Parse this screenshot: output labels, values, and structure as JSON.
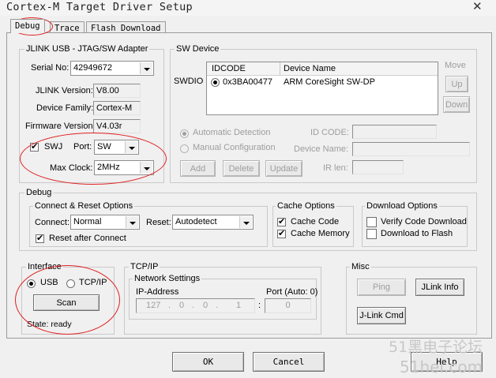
{
  "window": {
    "title": "Cortex-M Target Driver Setup",
    "close_glyph": "✕"
  },
  "tabs": [
    {
      "label": "Debug",
      "active": true
    },
    {
      "label": "Trace",
      "active": false
    },
    {
      "label": "Flash Download",
      "active": false
    }
  ],
  "jlink": {
    "group_title": "JLINK USB - JTAG/SW Adapter",
    "serial_label": "Serial No:",
    "serial_value": "42949672",
    "version_label": "JLINK Version:",
    "version_value": "V8.00",
    "family_label": "Device Family:",
    "family_value": "Cortex-M",
    "firmware_label": "Firmware Version:",
    "firmware_value": "V4.03r",
    "swj_label": "SWJ",
    "swj_checked": true,
    "port_label": "Port:",
    "port_value": "SW",
    "clock_label": "Max Clock:",
    "clock_value": "2MHz"
  },
  "sw_device": {
    "group_title": "SW Device",
    "swdio_label": "SWDIO",
    "columns": [
      "IDCODE",
      "Device Name"
    ],
    "rows": [
      {
        "idcode": "0x3BA00477",
        "device_name": "ARM CoreSight SW-DP",
        "selected": true
      }
    ],
    "move_label": "Move",
    "up_label": "Up",
    "down_label": "Down",
    "auto_detect_label": "Automatic Detection",
    "manual_config_label": "Manual Configuration",
    "idcode_label": "ID CODE:",
    "device_name_label": "Device Name:",
    "add_label": "Add",
    "delete_label": "Delete",
    "update_label": "Update",
    "ir_len_label": "IR len:"
  },
  "debug": {
    "group_title": "Debug",
    "connect_group_title": "Connect & Reset Options",
    "connect_label": "Connect:",
    "connect_value": "Normal",
    "reset_label": "Reset:",
    "reset_value": "Autodetect",
    "reset_after_connect_label": "Reset after Connect",
    "reset_after_connect_checked": true,
    "cache_group_title": "Cache Options",
    "cache_code_label": "Cache Code",
    "cache_code_checked": true,
    "cache_memory_label": "Cache Memory",
    "cache_memory_checked": true,
    "download_group_title": "Download Options",
    "verify_label": "Verify Code Download",
    "verify_checked": false,
    "download_flash_label": "Download to Flash",
    "download_flash_checked": false
  },
  "interface": {
    "group_title": "Interface",
    "usb_label": "USB",
    "usb_selected": true,
    "tcpip_label": "TCP/IP",
    "tcpip_selected": false,
    "scan_label": "Scan",
    "state_text": "State: ready"
  },
  "tcpip": {
    "group_title": "TCP/IP",
    "network_group_title": "Network Settings",
    "ip_label": "IP-Address",
    "ip_octets": [
      "127",
      "0",
      "0",
      "1"
    ],
    "port_label": "Port (Auto: 0)",
    "port_colon": ":",
    "port_value": "0"
  },
  "misc": {
    "group_title": "Misc",
    "ping_label": "Ping",
    "jlink_info_label": "JLink Info",
    "jlink_cmd_label": "J-Link Cmd"
  },
  "footer": {
    "ok_label": "OK",
    "cancel_label": "Cancel",
    "help_label": "Help"
  },
  "watermark": {
    "line1": "51黑电子论坛",
    "line2": "51hei.com"
  },
  "colors": {
    "annotation_red": "#e02020",
    "dialog_bg": "#f0f0f0"
  }
}
